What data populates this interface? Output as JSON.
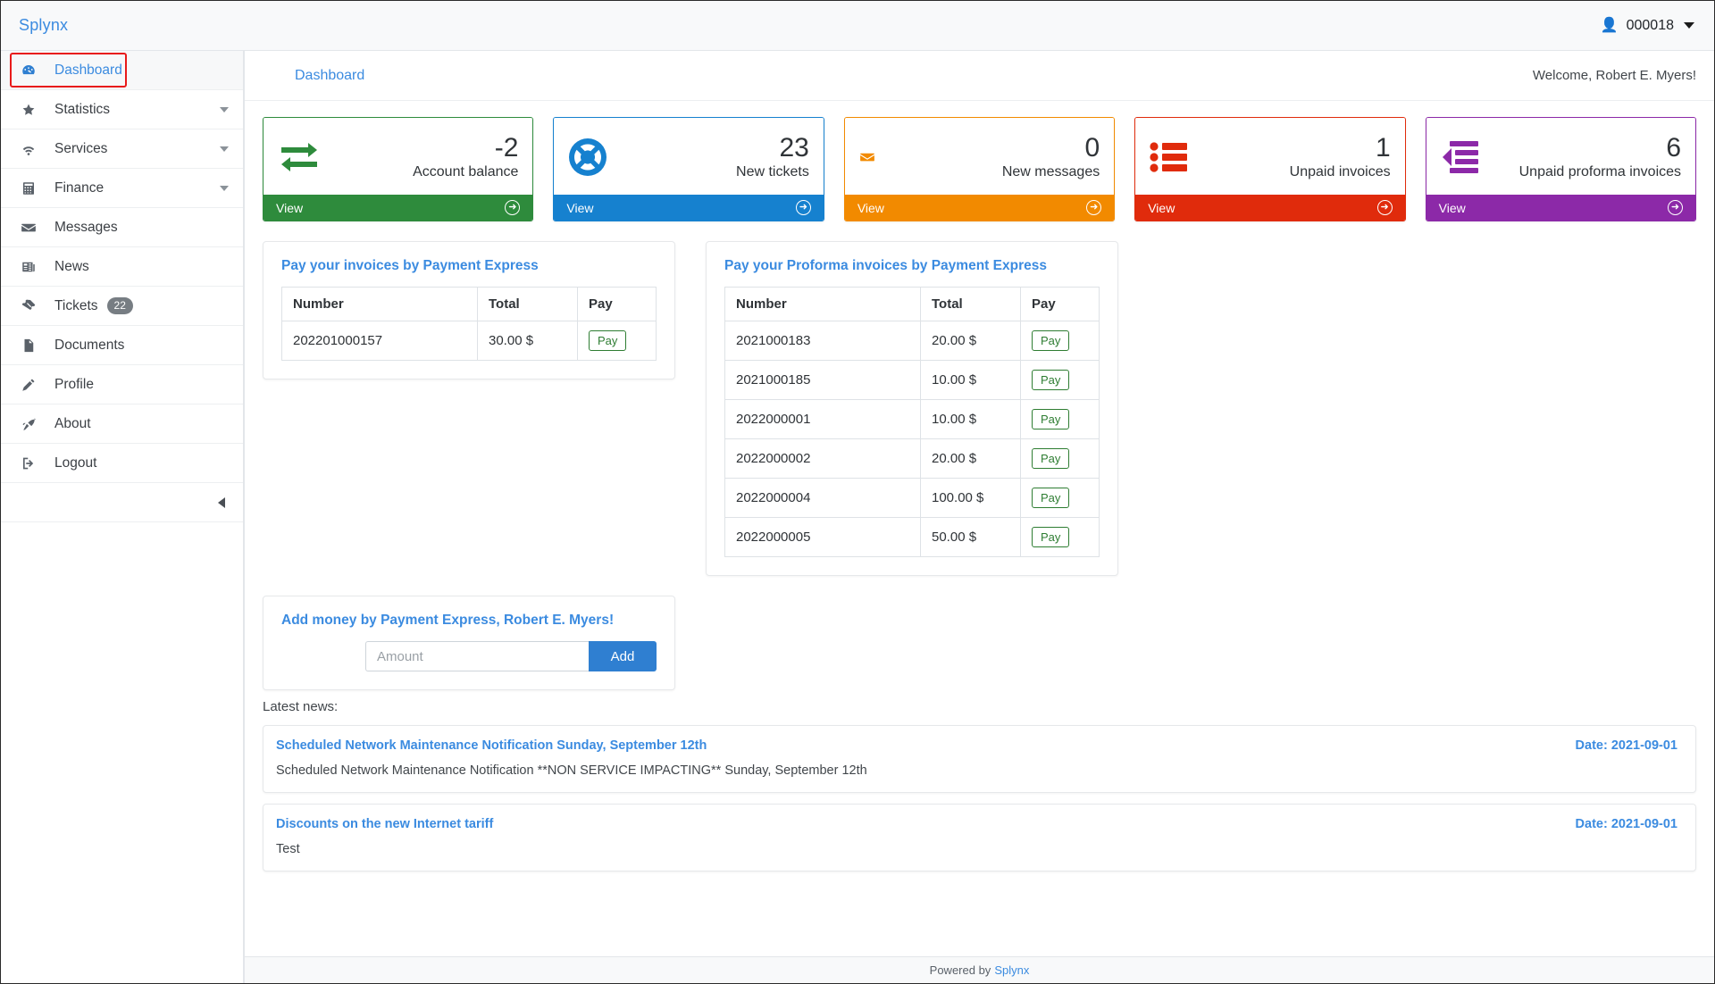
{
  "topbar": {
    "brand": "Splynx",
    "user_id": "000018",
    "user_icon": "user-icon"
  },
  "sidebar": {
    "items": [
      {
        "label": "Dashboard",
        "icon": "dashboard-icon",
        "active": true,
        "expandable": false,
        "badge": null
      },
      {
        "label": "Statistics",
        "icon": "star-icon",
        "active": false,
        "expandable": true,
        "badge": null
      },
      {
        "label": "Services",
        "icon": "wifi-icon",
        "active": false,
        "expandable": true,
        "badge": null
      },
      {
        "label": "Finance",
        "icon": "calculator-icon",
        "active": false,
        "expandable": true,
        "badge": null
      },
      {
        "label": "Messages",
        "icon": "envelope-icon",
        "active": false,
        "expandable": false,
        "badge": null
      },
      {
        "label": "News",
        "icon": "newspaper-icon",
        "active": false,
        "expandable": false,
        "badge": null
      },
      {
        "label": "Tickets",
        "icon": "ticket-icon",
        "active": false,
        "expandable": false,
        "badge": "22"
      },
      {
        "label": "Documents",
        "icon": "document-icon",
        "active": false,
        "expandable": false,
        "badge": null
      },
      {
        "label": "Profile",
        "icon": "pencil-icon",
        "active": false,
        "expandable": false,
        "badge": null
      },
      {
        "label": "About",
        "icon": "rocket-icon",
        "active": false,
        "expandable": false,
        "badge": null
      },
      {
        "label": "Logout",
        "icon": "logout-icon",
        "active": false,
        "expandable": false,
        "badge": null
      }
    ],
    "collapse_icon": "chevron-left-icon"
  },
  "header": {
    "breadcrumb": "Dashboard",
    "welcome": "Welcome, Robert E. Myers!"
  },
  "cards": [
    {
      "value": "-2",
      "label": "Account balance",
      "view": "View",
      "color": "#2e8b3c",
      "icon": "exchange-arrows-icon"
    },
    {
      "value": "23",
      "label": "New tickets",
      "view": "View",
      "color": "#1681cf",
      "icon": "lifebuoy-icon"
    },
    {
      "value": "0",
      "label": "New messages",
      "view": "View",
      "color": "#f28a00",
      "icon": "envelope-icon"
    },
    {
      "value": "1",
      "label": "Unpaid invoices",
      "view": "View",
      "color": "#e02b0c",
      "icon": "list-icon"
    },
    {
      "value": "6",
      "label": "Unpaid proforma invoices",
      "view": "View",
      "color": "#8c29a8",
      "icon": "proforma-list-icon"
    }
  ],
  "invoices_panel": {
    "title": "Pay your invoices by Payment Express",
    "columns": [
      "Number",
      "Total",
      "Pay"
    ],
    "pay_label": "Pay",
    "rows": [
      {
        "number": "202201000157",
        "total": "30.00 $"
      }
    ]
  },
  "proforma_panel": {
    "title": "Pay your Proforma invoices by Payment Express",
    "columns": [
      "Number",
      "Total",
      "Pay"
    ],
    "pay_label": "Pay",
    "rows": [
      {
        "number": "2021000183",
        "total": "20.00 $"
      },
      {
        "number": "2021000185",
        "total": "10.00 $"
      },
      {
        "number": "2022000001",
        "total": "10.00 $"
      },
      {
        "number": "2022000002",
        "total": "20.00 $"
      },
      {
        "number": "2022000004",
        "total": "100.00 $"
      },
      {
        "number": "2022000005",
        "total": "50.00 $"
      }
    ]
  },
  "add_money": {
    "title": "Add money by Payment Express, Robert E. Myers!",
    "amount_value": "",
    "amount_placeholder": "Amount",
    "add_label": "Add"
  },
  "news": {
    "heading": "Latest news:",
    "items": [
      {
        "title": "Scheduled Network Maintenance Notification Sunday, September 12th",
        "body": "Scheduled Network Maintenance Notification **NON SERVICE IMPACTING** Sunday, September 12th",
        "date": "Date: 2021-09-01"
      },
      {
        "title": "Discounts on the new Internet tariff",
        "body": "Test",
        "date": "Date: 2021-09-01"
      }
    ]
  },
  "footer": {
    "text": "Powered by",
    "link": "Splynx"
  }
}
